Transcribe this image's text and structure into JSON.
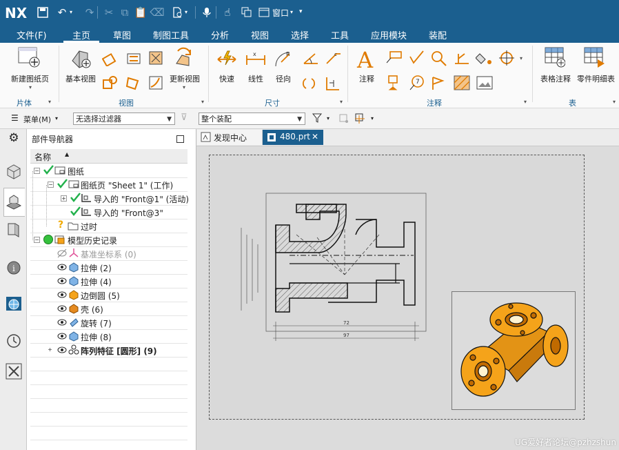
{
  "app": {
    "logo": "NX",
    "window_menu": "窗口"
  },
  "menubar": {
    "items": [
      "文件(F)",
      "主页",
      "草图",
      "制图工具",
      "分析",
      "视图",
      "选择",
      "工具",
      "应用模块",
      "装配"
    ],
    "active": "主页"
  },
  "ribbon": {
    "new_sheet": "新建图纸页",
    "base_view": "基本视图",
    "update_view": "更新视图",
    "rapid": "快速",
    "linear": "线性",
    "radial": "径向",
    "note": "注释",
    "table_note": "表格注释",
    "parts_list": "零件明细表",
    "groups": {
      "sheet": "片体",
      "view": "视图",
      "dimension": "尺寸",
      "annotation": "注释",
      "table": "表"
    }
  },
  "filterbar": {
    "menu": "菜单(M)",
    "filter": "无选择过滤器",
    "scope": "整个装配"
  },
  "navigator": {
    "title": "部件导航器",
    "column_name": "名称",
    "rows": [
      {
        "label": "图纸"
      },
      {
        "label": "图纸页 \"Sheet 1\" (工作)"
      },
      {
        "label": "导入的 \"Front@1\" (活动)"
      },
      {
        "label": "导入的 \"Front@3\""
      },
      {
        "label": "过时"
      },
      {
        "label": "模型历史记录"
      },
      {
        "label": "基准坐标系 (0)"
      },
      {
        "label": "拉伸 (2)"
      },
      {
        "label": "拉伸 (4)"
      },
      {
        "label": "边倒圆 (5)"
      },
      {
        "label": "壳 (6)"
      },
      {
        "label": "旋转 (7)"
      },
      {
        "label": "拉伸 (8)"
      },
      {
        "label": "阵列特征 [圆形] (9)"
      }
    ]
  },
  "tabs": [
    {
      "label": "发现中心"
    },
    {
      "label": "480.prt",
      "close": "✕"
    }
  ],
  "drawing": {
    "dim_overall": "97",
    "dim_inner": "72"
  },
  "watermark": "UG爱好者论坛@pzhzshun",
  "colors": {
    "brand": "#1b5f8f",
    "check": "#22b14c",
    "model_orange": "#f5a31a"
  }
}
